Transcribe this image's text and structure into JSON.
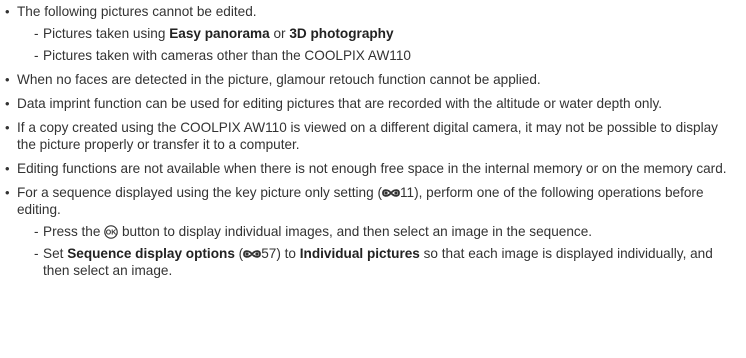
{
  "items": [
    {
      "text": "The following pictures cannot be edited.",
      "subs": [
        {
          "parts": [
            "Pictures taken using ",
            "Easy panorama",
            " or ",
            "3D photography"
          ]
        },
        {
          "text": "Pictures taken with cameras other than the COOLPIX AW110"
        }
      ]
    },
    {
      "text": "When no faces are detected in the picture, glamour retouch function cannot be applied."
    },
    {
      "text": "Data imprint function can be used for editing pictures that are recorded with the altitude or water depth only."
    },
    {
      "text": "If a copy created using the COOLPIX AW110 is viewed on a different digital camera, it may not be possible to display the picture properly or transfer it to a computer."
    },
    {
      "text": "Editing functions are not available when there is not enough free space in the internal memory or on the memory card."
    },
    {
      "parts": [
        "For a sequence displayed using the key picture only setting (",
        "11), perform one of the following operations before editing."
      ],
      "subs": [
        {
          "parts": [
            "Press the ",
            " button to display individual images, and then select an image in the sequence."
          ]
        },
        {
          "parts": [
            "Set ",
            "Sequence display options",
            " (",
            "57) to ",
            "Individual pictures",
            " so that each image is displayed individually, and then select an image."
          ]
        }
      ]
    }
  ],
  "icons": {
    "reference": "reference-link-icon",
    "ok": "ok-button-icon"
  },
  "colors": {
    "text": "#333333",
    "bold": "#222222",
    "background": "#ffffff"
  }
}
